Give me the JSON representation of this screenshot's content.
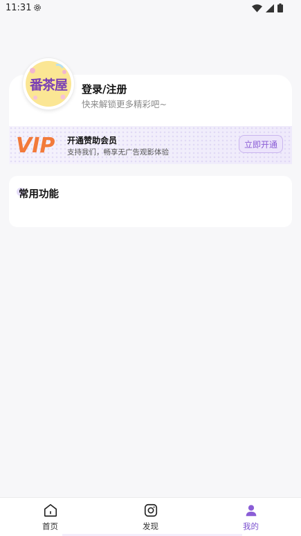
{
  "status_bar": {
    "time": "11:31",
    "icons": [
      "settings-icon",
      "wifi-icon",
      "signal-icon",
      "battery-icon"
    ]
  },
  "profile": {
    "avatar_text": "番茶屋",
    "login_title": "登录/注册",
    "login_subtitle": "快来解锁更多精彩吧~"
  },
  "vip": {
    "logo_text": "VIP",
    "title": "开通赞助会员",
    "description": "支持我们，畅享无广告观影体验",
    "button_label": "立即开通"
  },
  "common_functions": {
    "title": "常用功能"
  },
  "bottom_nav": {
    "items": [
      {
        "label": "首页",
        "icon": "home-icon"
      },
      {
        "label": "发现",
        "icon": "instagram-icon"
      },
      {
        "label": "我的",
        "icon": "user-icon"
      }
    ],
    "active_index": 2
  },
  "colors": {
    "accent": "#7a4fcf",
    "vip_orange": "#f27a3a",
    "background": "#f7f7f9"
  }
}
